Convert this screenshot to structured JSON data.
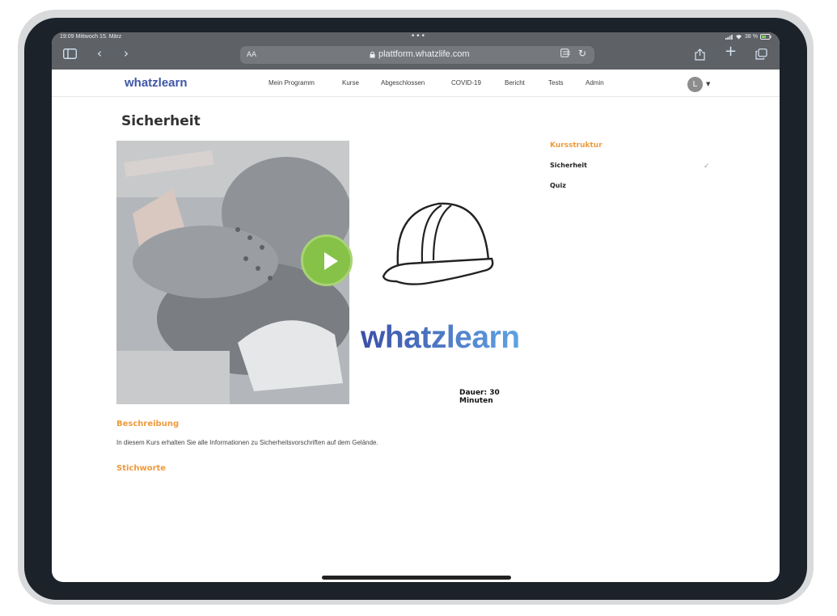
{
  "status": {
    "time": "19:09",
    "date": "Mittwoch 15. März",
    "battery": "38 %"
  },
  "browser": {
    "text_size": "AA",
    "url": "plattform.whatzlife.com"
  },
  "nav": {
    "logo": "whatzlearn",
    "links": [
      "Mein Programm",
      "Kurse",
      "Abgeschlossen",
      "COVID-19",
      "Bericht",
      "Tests",
      "Admin"
    ],
    "avatar": "L"
  },
  "course": {
    "title": "Sicherheit",
    "logo": "whatzlearn",
    "duration": "Dauer: 30 Minuten",
    "description_title": "Beschreibung",
    "description": "In diesem Kurs erhalten Sie alle Informationen zu Sicherheitsvorschriften auf dem Gelände.",
    "keywords_title": "Stichworte"
  },
  "structure": {
    "title": "Kursstruktur",
    "items": [
      {
        "label": "Sicherheit",
        "done": true
      },
      {
        "label": "Quiz",
        "done": false
      }
    ]
  },
  "colors": {
    "accent": "#ee9a3c",
    "brand": "#3f55a5",
    "play": "#86c247"
  },
  "icons": [
    "sidebar-icon",
    "back-icon",
    "forward-icon",
    "lock-icon",
    "reader-icon",
    "reload-icon",
    "share-icon",
    "plus-icon",
    "tabs-icon",
    "play-icon",
    "hard-hat-icon",
    "check-icon"
  ]
}
